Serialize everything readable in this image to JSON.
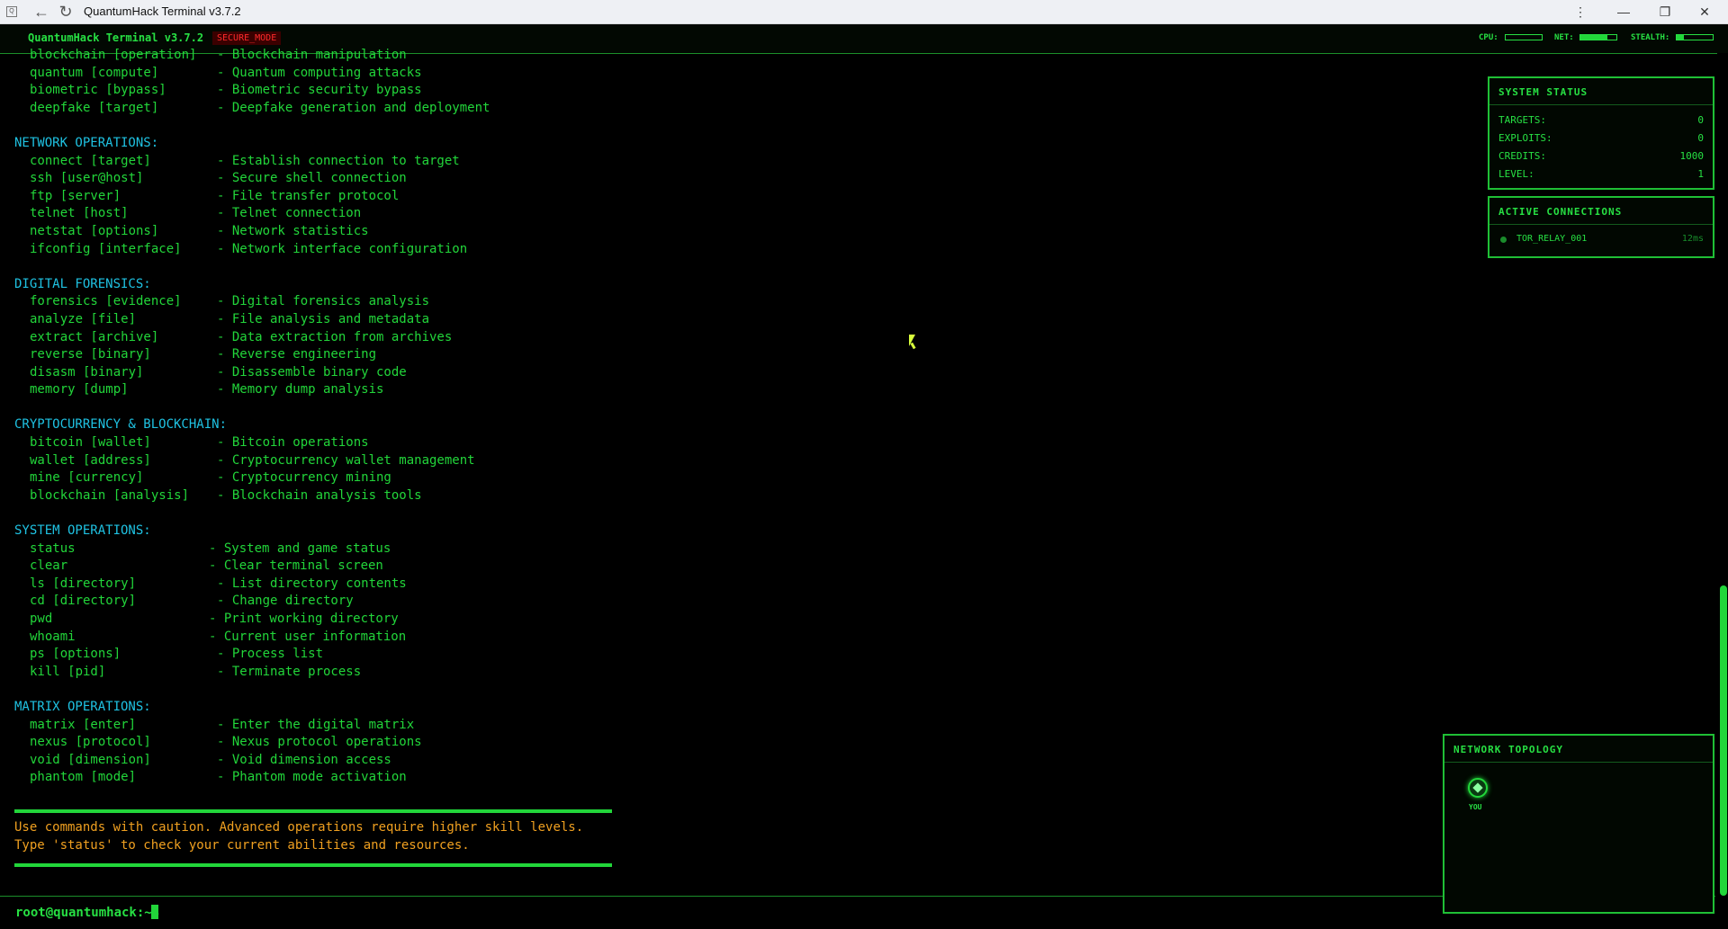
{
  "browser": {
    "app_icon": "Q",
    "title": "QuantumHack Terminal v3.7.2",
    "back_icon": "back-arrow-icon",
    "reload_icon": "reload-icon",
    "menu_icon": "more-vertical-icon"
  },
  "header": {
    "title": "QuantumHack Terminal v3.7.2",
    "badge": "SECURE_MODE",
    "meters": [
      {
        "label": "CPU:",
        "level": 0.0
      },
      {
        "label": "NET:",
        "level": 0.75
      },
      {
        "label": "STEALTH:",
        "level": 0.2
      }
    ]
  },
  "output": {
    "lines": [
      {
        "type": "cmd",
        "cmd": "blockchain [operation]",
        "desc": "- Blockchain manipulation"
      },
      {
        "type": "cmd",
        "cmd": "quantum [compute]",
        "desc": "- Quantum computing attacks"
      },
      {
        "type": "cmd",
        "cmd": "biometric [bypass]",
        "desc": "- Biometric security bypass"
      },
      {
        "type": "cmd",
        "cmd": "deepfake [target]",
        "desc": "- Deepfake generation and deployment"
      },
      {
        "type": "blank"
      },
      {
        "type": "section",
        "text": "NETWORK OPERATIONS:"
      },
      {
        "type": "cmd",
        "cmd": "connect [target]",
        "desc": "- Establish connection to target"
      },
      {
        "type": "cmd",
        "cmd": "ssh [user@host]",
        "desc": "- Secure shell connection"
      },
      {
        "type": "cmd",
        "cmd": "ftp [server]",
        "desc": "- File transfer protocol"
      },
      {
        "type": "cmd",
        "cmd": "telnet [host]",
        "desc": "- Telnet connection"
      },
      {
        "type": "cmd",
        "cmd": "netstat [options]",
        "desc": "- Network statistics"
      },
      {
        "type": "cmd",
        "cmd": "ifconfig [interface]",
        "desc": "- Network interface configuration"
      },
      {
        "type": "blank"
      },
      {
        "type": "section",
        "text": "DIGITAL FORENSICS:"
      },
      {
        "type": "cmd",
        "cmd": "forensics [evidence]",
        "desc": "- Digital forensics analysis"
      },
      {
        "type": "cmd",
        "cmd": "analyze [file]",
        "desc": "- File analysis and metadata"
      },
      {
        "type": "cmd",
        "cmd": "extract [archive]",
        "desc": "- Data extraction from archives"
      },
      {
        "type": "cmd",
        "cmd": "reverse [binary]",
        "desc": "- Reverse engineering"
      },
      {
        "type": "cmd",
        "cmd": "disasm [binary]",
        "desc": "- Disassemble binary code"
      },
      {
        "type": "cmd",
        "cmd": "memory [dump]",
        "desc": "- Memory dump analysis"
      },
      {
        "type": "blank"
      },
      {
        "type": "section",
        "text": "CRYPTOCURRENCY & BLOCKCHAIN:"
      },
      {
        "type": "cmd",
        "cmd": "bitcoin [wallet]",
        "desc": "- Bitcoin operations"
      },
      {
        "type": "cmd",
        "cmd": "wallet [address]",
        "desc": "- Cryptocurrency wallet management"
      },
      {
        "type": "cmd",
        "cmd": "mine [currency]",
        "desc": "- Cryptocurrency mining"
      },
      {
        "type": "cmd",
        "cmd": "blockchain [analysis]",
        "desc": "- Blockchain analysis tools"
      },
      {
        "type": "blank"
      },
      {
        "type": "section",
        "text": "SYSTEM OPERATIONS:"
      },
      {
        "type": "cmd",
        "cmd": "status",
        "desc": "- System and game status",
        "short": true
      },
      {
        "type": "cmd",
        "cmd": "clear",
        "desc": "- Clear terminal screen",
        "short": true
      },
      {
        "type": "cmd",
        "cmd": "ls [directory]",
        "desc": "- List directory contents"
      },
      {
        "type": "cmd",
        "cmd": "cd [directory]",
        "desc": "- Change directory"
      },
      {
        "type": "cmd",
        "cmd": "pwd",
        "desc": "- Print working directory",
        "short": true
      },
      {
        "type": "cmd",
        "cmd": "whoami",
        "desc": "- Current user information",
        "short": true
      },
      {
        "type": "cmd",
        "cmd": "ps [options]",
        "desc": "- Process list"
      },
      {
        "type": "cmd",
        "cmd": "kill [pid]",
        "desc": "- Terminate process"
      },
      {
        "type": "blank"
      },
      {
        "type": "section",
        "text": "MATRIX OPERATIONS:"
      },
      {
        "type": "cmd",
        "cmd": "matrix [enter]",
        "desc": "- Enter the digital matrix"
      },
      {
        "type": "cmd",
        "cmd": "nexus [protocol]",
        "desc": "- Nexus protocol operations"
      },
      {
        "type": "cmd",
        "cmd": "void [dimension]",
        "desc": "- Void dimension access"
      },
      {
        "type": "cmd",
        "cmd": "phantom [mode]",
        "desc": "- Phantom mode activation"
      }
    ],
    "warning_lines": [
      "Use commands with caution. Advanced operations require higher skill levels.",
      "Type 'status' to check your current abilities and resources."
    ]
  },
  "prompt": {
    "text": "root@quantumhack:~$"
  },
  "system_status": {
    "title": "SYSTEM STATUS",
    "stats": [
      {
        "label": "TARGETS:",
        "value": "0"
      },
      {
        "label": "EXPLOITS:",
        "value": "0"
      },
      {
        "label": "CREDITS:",
        "value": "1000"
      },
      {
        "label": "LEVEL:",
        "value": "1"
      }
    ]
  },
  "active_connections": {
    "title": "ACTIVE CONNECTIONS",
    "items": [
      {
        "name": "TOR_RELAY_001",
        "latency": "12ms"
      }
    ]
  },
  "network_topology": {
    "title": "NETWORK TOPOLOGY",
    "nodes": [
      {
        "label": "YOU",
        "icon": "diamond-node-icon"
      }
    ]
  },
  "colors": {
    "accent": "#22d63a",
    "section": "#1fc2e2",
    "warning": "#f0a020",
    "badge": "#ff2a2a"
  }
}
